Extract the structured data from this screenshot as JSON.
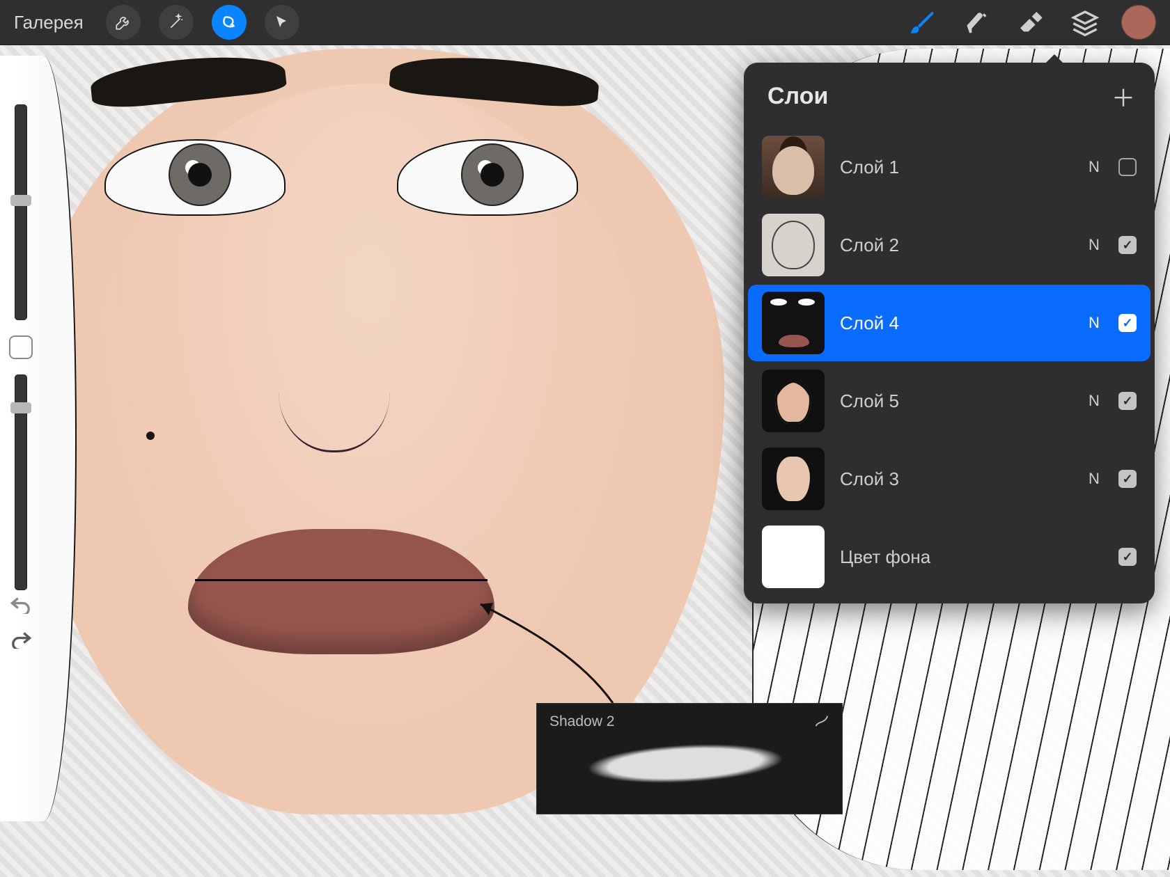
{
  "topbar": {
    "gallery_label": "Галерея",
    "tools_left": [
      {
        "name": "wrench-icon",
        "active": false
      },
      {
        "name": "wand-icon",
        "active": false
      },
      {
        "name": "selection-icon",
        "active": true
      },
      {
        "name": "pointer-icon",
        "active": false
      }
    ],
    "tools_right": [
      {
        "name": "brush-icon",
        "active": true
      },
      {
        "name": "smudge-icon",
        "active": false
      },
      {
        "name": "eraser-icon",
        "active": false
      },
      {
        "name": "layers-icon",
        "active": false
      }
    ],
    "color_swatch": "#aa675a"
  },
  "layers_panel": {
    "title": "Слои",
    "layers": [
      {
        "name": "Слой 1",
        "blend": "N",
        "visible": false,
        "selected": false,
        "thumb": "photo"
      },
      {
        "name": "Слой 2",
        "blend": "N",
        "visible": true,
        "selected": false,
        "thumb": "sketch"
      },
      {
        "name": "Слой 4",
        "blend": "N",
        "visible": true,
        "selected": true,
        "thumb": "layer4"
      },
      {
        "name": "Слой 5",
        "blend": "N",
        "visible": true,
        "selected": false,
        "thumb": "layer5"
      },
      {
        "name": "Слой 3",
        "blend": "N",
        "visible": true,
        "selected": false,
        "thumb": "layer3"
      },
      {
        "name": "Цвет фона",
        "blend": "",
        "visible": true,
        "selected": false,
        "thumb": "bg"
      }
    ]
  },
  "brush_card": {
    "title": "Shadow 2"
  }
}
